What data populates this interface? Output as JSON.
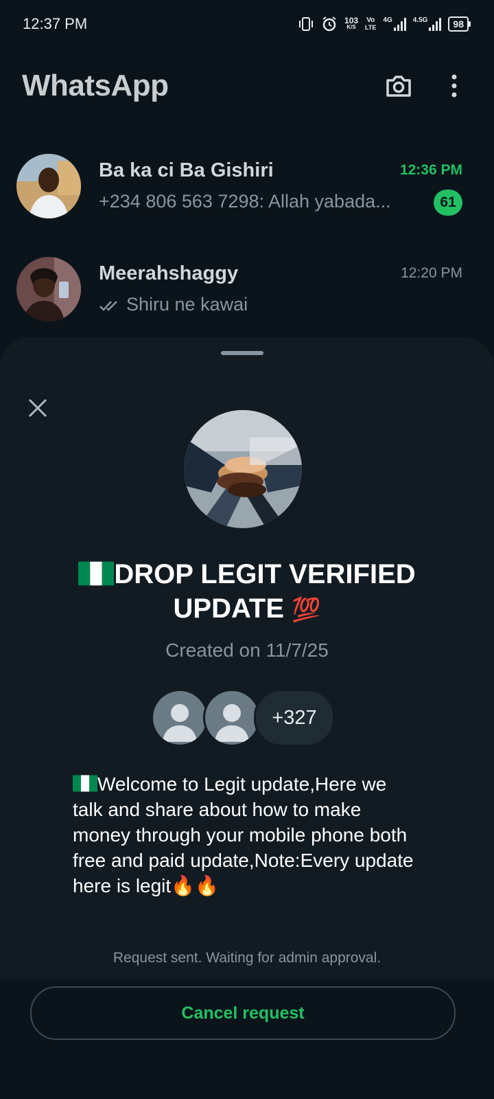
{
  "status_bar": {
    "time": "12:37 PM",
    "net_speed_value": "103",
    "net_speed_unit": "K/S",
    "volte_top": "Vo",
    "volte_bottom": "LTE",
    "network_1": "4G",
    "network_2": "4.5G",
    "battery": "98"
  },
  "header": {
    "title": "WhatsApp",
    "icons": [
      "camera-icon",
      "more-vertical-icon"
    ]
  },
  "chats": [
    {
      "name": "Ba ka ci Ba Gishiri",
      "time": "12:36 PM",
      "preview": "+234 806 563 7298: Allah yabada...",
      "unread_count": "61"
    },
    {
      "name": "Meerahshaggy",
      "time": "12:20 PM",
      "preview": "Shiru ne kawai",
      "status_icon": "double-check-icon"
    }
  ],
  "sheet": {
    "close_icon": "close-icon",
    "group_title_line1": "DROP LEGIT VERIFIED",
    "group_title_line2": "UPDATE",
    "title_emoji": "💯",
    "created": "Created on 11/7/25",
    "member_more": "+327",
    "description": "Welcome to Legit update,Here we talk and share about how to make money through your mobile phone both free and paid update,Note:Every update here is legit",
    "description_emoji": "🔥🔥",
    "request_note": "Request sent. Waiting for admin approval.",
    "cancel_label": "Cancel request"
  },
  "colors": {
    "background": "#0b141a",
    "sheet": "#121b22",
    "accent_green": "#21c063",
    "muted_text": "#8696a0"
  }
}
